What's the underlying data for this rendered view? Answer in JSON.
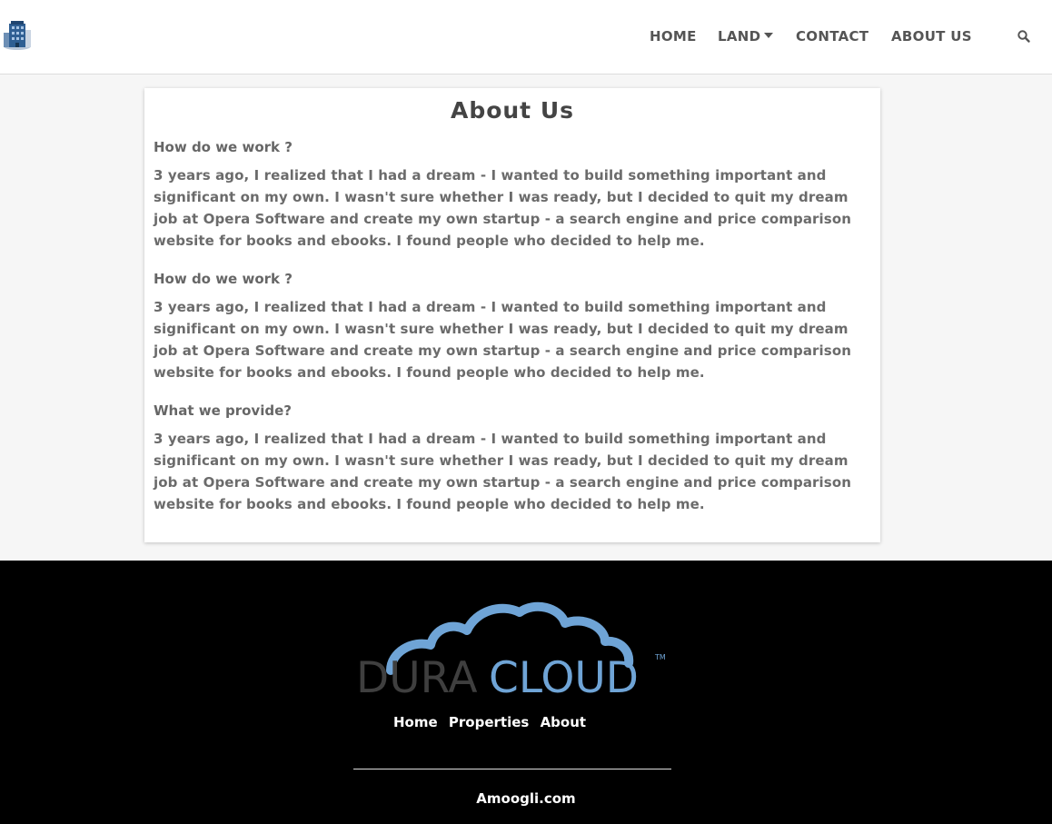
{
  "nav": {
    "logo_icon": "building-logo-icon",
    "items": [
      "HOME",
      "LAND",
      "CONTACT",
      "ABOUT US"
    ],
    "search_icon": "search-icon"
  },
  "about": {
    "title": "About Us",
    "sections": [
      {
        "heading": "How do we work ?",
        "body": "3 years ago, I realized that I had a dream - I wanted to build something important and significant on my own. I wasn't sure whether I was ready, but I decided to quit my dream job at Opera Software and create my own startup - a search engine and price comparison website for books and ebooks. I found people who decided to help me."
      },
      {
        "heading": "How do we work ?",
        "body": "3 years ago, I realized that I had a dream - I wanted to build something important and significant on my own. I wasn't sure whether I was ready, but I decided to quit my dream job at Opera Software and create my own startup - a search engine and price comparison website for books and ebooks. I found people who decided to help me."
      },
      {
        "heading": "What we provide?",
        "body": "3 years ago, I realized that I had a dream - I wanted to build something important and significant on my own. I wasn't sure whether I was ready, but I decided to quit my dream job at Opera Software and create my own startup - a search engine and price comparison website for books and ebooks. I found people who decided to help me."
      }
    ]
  },
  "footer": {
    "brand": {
      "part1": "DURA",
      "part2": "CLOUD",
      "tm": "TM"
    },
    "links": [
      "Home",
      "Properties",
      "About"
    ],
    "copyright": "Amoogli.com"
  },
  "colors": {
    "brand_gray": "#3f3f3f",
    "brand_blue": "#6fa4d6",
    "footer_bg": "#000000"
  }
}
